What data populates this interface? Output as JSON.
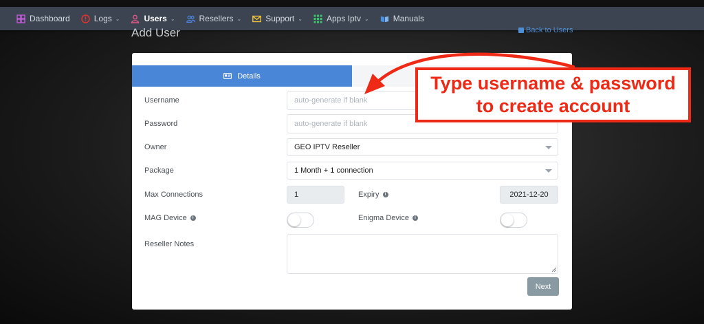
{
  "nav": {
    "items": [
      {
        "label": "Dashboard",
        "icon": "dashboard-icon",
        "color": "#c15bd6",
        "caret": false,
        "active": false
      },
      {
        "label": "Logs",
        "icon": "alert-icon",
        "color": "#e3342f",
        "caret": true,
        "active": false
      },
      {
        "label": "Users",
        "icon": "user-icon",
        "color": "#e8578a",
        "caret": true,
        "active": true
      },
      {
        "label": "Resellers",
        "icon": "users-icon",
        "color": "#4f8df5",
        "caret": true,
        "active": false
      },
      {
        "label": "Support",
        "icon": "mail-icon",
        "color": "#f2c23a",
        "caret": true,
        "active": false
      },
      {
        "label": "Apps Iptv",
        "icon": "grid-icon",
        "color": "#3cc36b",
        "caret": true,
        "active": false
      },
      {
        "label": "Manuals",
        "icon": "book-icon",
        "color": "#4a90e2",
        "caret": false,
        "active": false
      }
    ]
  },
  "page": {
    "title": "Add User",
    "back_link": "Back to Users"
  },
  "tabs": {
    "details": "Details"
  },
  "form": {
    "username_label": "Username",
    "username_placeholder": "auto-generate if blank",
    "password_label": "Password",
    "password_placeholder": "auto-generate if blank",
    "owner_label": "Owner",
    "owner_value": "GEO IPTV Reseller",
    "package_label": "Package",
    "package_value": "1 Month + 1 connection",
    "max_connections_label": "Max Connections",
    "max_connections_value": "1",
    "expiry_label": "Expiry",
    "expiry_value": "2021-12-20",
    "mag_label": "MAG Device",
    "mag_on": false,
    "enigma_label": "Enigma Device",
    "enigma_on": false,
    "notes_label": "Reseller Notes",
    "notes_value": "",
    "next_label": "Next"
  },
  "annotation": {
    "line1": "Type username & password",
    "line2": "to create account",
    "color": "#ee2a17"
  }
}
